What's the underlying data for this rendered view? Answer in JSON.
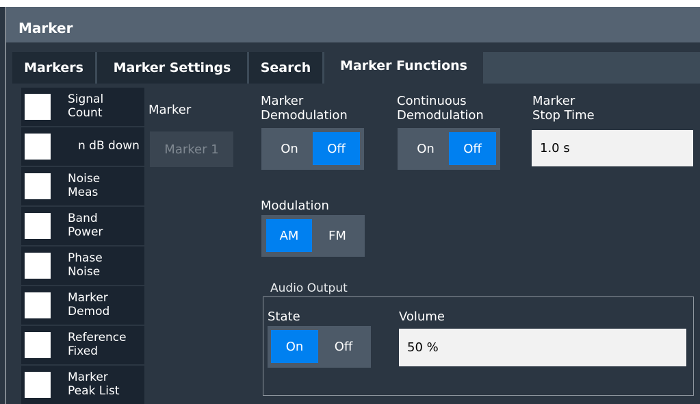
{
  "window": {
    "title": "Marker"
  },
  "tabs": [
    {
      "label": "Markers",
      "active": false
    },
    {
      "label": "Marker Settings",
      "active": false
    },
    {
      "label": "Search",
      "active": false
    },
    {
      "label": "Marker Functions",
      "active": true
    }
  ],
  "functions": [
    {
      "label": "Signal\nCount",
      "checked": false
    },
    {
      "label": "n dB down",
      "checked": false
    },
    {
      "label": "Noise\nMeas",
      "checked": false
    },
    {
      "label": "Band\nPower",
      "checked": false
    },
    {
      "label": "Phase\nNoise",
      "checked": false
    },
    {
      "label": "Marker\nDemod",
      "checked": false
    },
    {
      "label": "Reference\nFixed",
      "checked": false
    },
    {
      "label": "Marker\nPeak List",
      "checked": false
    }
  ],
  "marker": {
    "label": "Marker",
    "value": "Marker 1"
  },
  "marker_demodulation": {
    "label": "Marker\nDemodulation",
    "on_label": "On",
    "off_label": "Off",
    "selected": "Off"
  },
  "continuous_demodulation": {
    "label": "Continuous\nDemodulation",
    "on_label": "On",
    "off_label": "Off",
    "selected": "Off"
  },
  "marker_stop_time": {
    "label": "Marker\nStop Time",
    "value": "1.0 s"
  },
  "modulation": {
    "label": "Modulation",
    "am_label": "AM",
    "fm_label": "FM",
    "selected": "AM"
  },
  "audio_output": {
    "legend": "Audio Output",
    "state": {
      "label": "State",
      "on_label": "On",
      "off_label": "Off",
      "selected": "On"
    },
    "volume": {
      "label": "Volume",
      "value": "50 %"
    }
  },
  "colors": {
    "accent": "#0080f0",
    "panel": "#2b3642",
    "title_bar": "#556372"
  }
}
